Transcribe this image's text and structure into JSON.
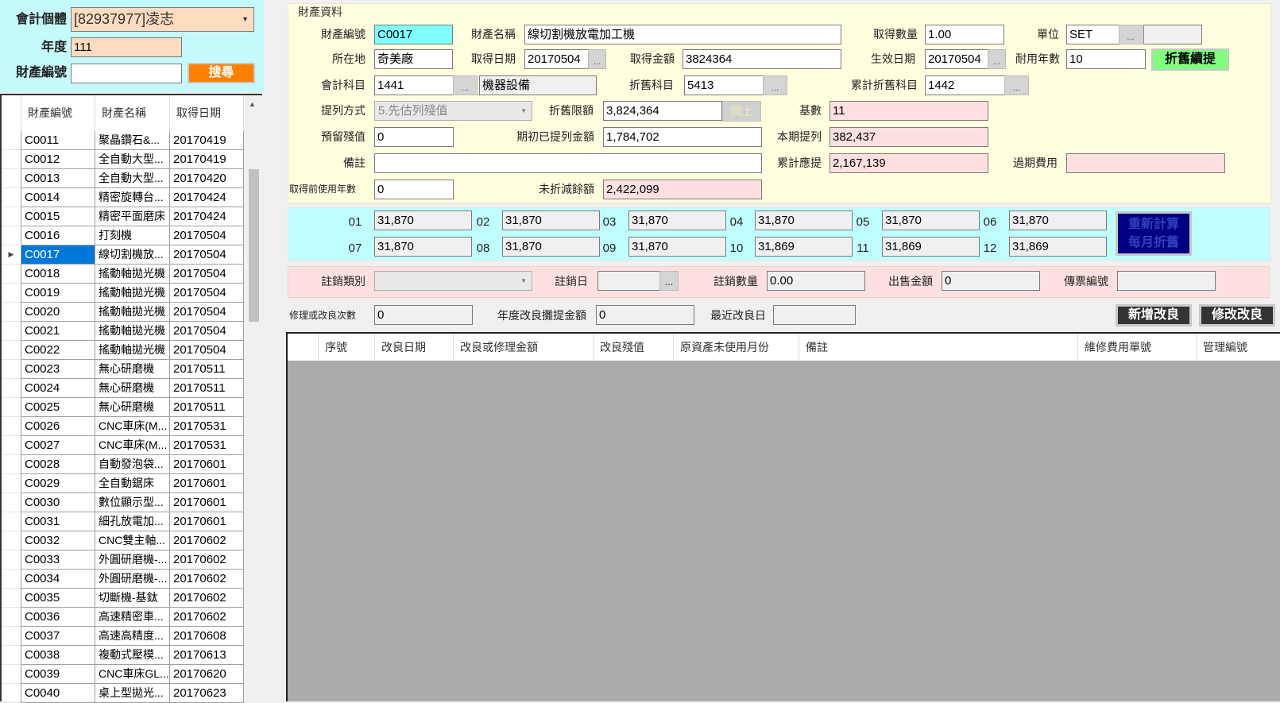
{
  "search": {
    "entity_label": "會計個體",
    "entity_value": "[82937977]凌志",
    "year_label": "年度",
    "year_value": "111",
    "asset_no_label": "財產編號",
    "asset_no_value": "",
    "search_button": "搜尋"
  },
  "asset_list": {
    "columns": [
      "財產編號",
      "財產名稱",
      "取得日期"
    ],
    "selected_index": 6,
    "rows": [
      [
        "C0011",
        "聚晶鑽石&...",
        "20170419"
      ],
      [
        "C0012",
        "全自動大型...",
        "20170419"
      ],
      [
        "C0013",
        "全自動大型...",
        "20170420"
      ],
      [
        "C0014",
        "精密旋轉台...",
        "20170424"
      ],
      [
        "C0015",
        "精密平面磨床",
        "20170424"
      ],
      [
        "C0016",
        "打刻機",
        "20170504"
      ],
      [
        "C0017",
        "線切割機放...",
        "20170504"
      ],
      [
        "C0018",
        "搖動軸拋光機",
        "20170504"
      ],
      [
        "C0019",
        "搖動軸拋光機",
        "20170504"
      ],
      [
        "C0020",
        "搖動軸拋光機",
        "20170504"
      ],
      [
        "C0021",
        "搖動軸拋光機",
        "20170504"
      ],
      [
        "C0022",
        "搖動軸拋光機",
        "20170504"
      ],
      [
        "C0023",
        "無心研磨機",
        "20170511"
      ],
      [
        "C0024",
        "無心研磨機",
        "20170511"
      ],
      [
        "C0025",
        "無心研磨機",
        "20170511"
      ],
      [
        "C0026",
        "CNC車床(M...",
        "20170531"
      ],
      [
        "C0027",
        "CNC車床(M...",
        "20170531"
      ],
      [
        "C0028",
        "自動發泡袋...",
        "20170601"
      ],
      [
        "C0029",
        "全自動鋸床",
        "20170601"
      ],
      [
        "C0030",
        "數位顯示型...",
        "20170601"
      ],
      [
        "C0031",
        "細孔放電加...",
        "20170601"
      ],
      [
        "C0032",
        "CNC雙主軸...",
        "20170602"
      ],
      [
        "C0033",
        "外圓研磨機-...",
        "20170602"
      ],
      [
        "C0034",
        "外圓研磨機-...",
        "20170602"
      ],
      [
        "C0035",
        "切斷機-基鈦",
        "20170602"
      ],
      [
        "C0036",
        "高速精密車...",
        "20170602"
      ],
      [
        "C0037",
        "高速高精度...",
        "20170608"
      ],
      [
        "C0038",
        "複動式壓模...",
        "20170613"
      ],
      [
        "C0039",
        "CNC車床GL...",
        "20170620"
      ],
      [
        "C0040",
        "桌上型拋光...",
        "20170623"
      ]
    ]
  },
  "asset": {
    "group_title": "財產資料",
    "asset_no_label": "財產編號",
    "asset_no": "C0017",
    "name_label": "財產名稱",
    "name": "線切割機放電加工機",
    "qty_label": "取得數量",
    "qty": "1.00",
    "unit_label": "單位",
    "unit": "SET",
    "unit_desc": "",
    "location_label": "所在地",
    "location": "奇美廠",
    "acq_date_label": "取得日期",
    "acq_date": "20170504",
    "acq_amount_label": "取得金額",
    "acq_amount": "3824364",
    "eff_date_label": "生效日期",
    "eff_date": "20170504",
    "life_label": "耐用年數",
    "life": "10",
    "continue_dep_button": "折舊續提",
    "account_label": "會計科目",
    "account": "1441",
    "account_name": "機器設備",
    "dep_account_label": "折舊科目",
    "dep_account": "5413",
    "acc_dep_account_label": "累計折舊科目",
    "acc_dep_account": "1442",
    "method_label": "提列方式",
    "method": "5.先估列殘值",
    "dep_limit_label": "折舊限額",
    "dep_limit": "3,824,364",
    "same_button": "同上",
    "base_label": "基數",
    "base": "11",
    "residual_label": "預留殘值",
    "residual": "0",
    "opening_dep_label": "期初已提列金額",
    "opening_dep": "1,784,702",
    "current_dep_label": "本期提列",
    "current_dep": "382,437",
    "remark_label": "備註",
    "remark": "",
    "acc_required_label": "累計應提",
    "acc_required": "2,167,139",
    "overdue_label": "過期費用",
    "overdue": "",
    "prior_years_label": "取得前使用年數",
    "prior_years": "0",
    "undepreciated_label": "未折減餘額",
    "undepreciated": "2,422,099",
    "dots": "..."
  },
  "monthly": {
    "months": [
      {
        "label": "01",
        "value": "31,870"
      },
      {
        "label": "02",
        "value": "31,870"
      },
      {
        "label": "03",
        "value": "31,870"
      },
      {
        "label": "04",
        "value": "31,870"
      },
      {
        "label": "05",
        "value": "31,870"
      },
      {
        "label": "06",
        "value": "31,870"
      },
      {
        "label": "07",
        "value": "31,870"
      },
      {
        "label": "08",
        "value": "31,870"
      },
      {
        "label": "09",
        "value": "31,870"
      },
      {
        "label": "10",
        "value": "31,869"
      },
      {
        "label": "11",
        "value": "31,869"
      },
      {
        "label": "12",
        "value": "31,869"
      }
    ],
    "recalc_button_line1": "重新計算",
    "recalc_button_line2": "每月折舊"
  },
  "disposal": {
    "type_label": "註銷類別",
    "type": "",
    "date_label": "註銷日",
    "date": "",
    "qty_label": "註銷數量",
    "qty": "0.00",
    "sale_label": "出售金額",
    "sale": "0",
    "voucher_label": "傳票編號",
    "voucher": ""
  },
  "improvement": {
    "count_label": "修理或改良次數",
    "count": "0",
    "amort_label": "年度改良攤提金額",
    "amort": "0",
    "last_date_label": "最近改良日",
    "last_date": "",
    "add_button": "新增改良",
    "edit_button": "修改改良",
    "columns": [
      "序號",
      "改良日期",
      "改良或修理金額",
      "改良殘值",
      "原資產未使用月份",
      "備註",
      "維修費用單號",
      "管理編號"
    ]
  },
  "colors": {
    "search_button": "#ff8000",
    "continue_button": "#80ff80",
    "recalc_button": "#000080",
    "selected_row": "#0078d7"
  }
}
